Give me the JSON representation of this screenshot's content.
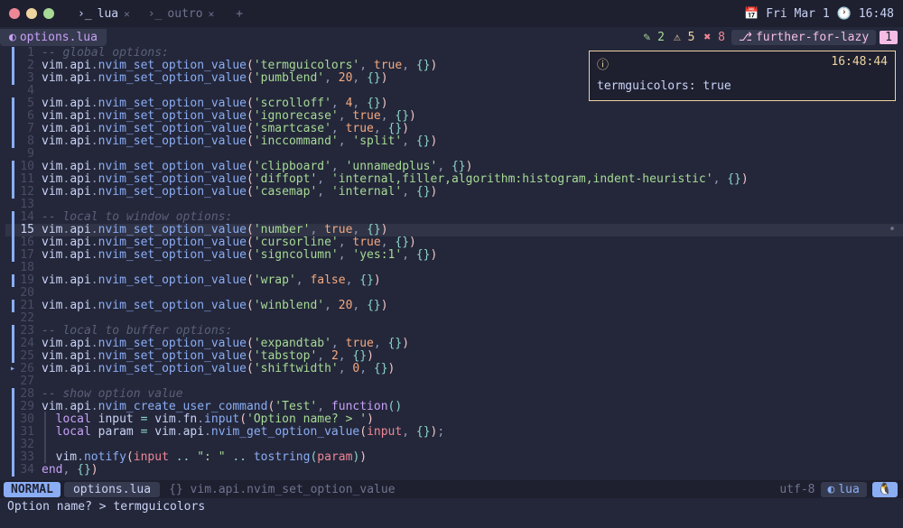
{
  "titlebar": {
    "tabs": [
      {
        "icon": "›_",
        "label": "lua",
        "active": true
      },
      {
        "icon": "›_",
        "label": "outro",
        "active": false
      }
    ],
    "date": "Fri Mar 1",
    "time": "16:48"
  },
  "bufferline": {
    "file": "options.lua",
    "diagnostics": {
      "edits": "2",
      "warnings": "5",
      "errors": "8"
    },
    "branch": "further-for-lazy",
    "branch_count": "1"
  },
  "notification": {
    "time": "16:48:44",
    "message": "termguicolors: true"
  },
  "code_lines": [
    {
      "n": 1,
      "git": "bar",
      "tokens": [
        [
          "comment",
          "-- global options:"
        ]
      ]
    },
    {
      "n": 2,
      "git": "bar",
      "tokens": [
        [
          "id",
          "vim"
        ],
        [
          "punc",
          "."
        ],
        [
          "id",
          "api"
        ],
        [
          "punc",
          "."
        ],
        [
          "fn",
          "nvim_set_option_value"
        ],
        [
          "brc",
          "("
        ],
        [
          "str",
          "'termguicolors'"
        ],
        [
          "punc",
          ", "
        ],
        [
          "bool",
          "true"
        ],
        [
          "punc",
          ", "
        ],
        [
          "brc2",
          "{}"
        ],
        [
          "brc",
          ")"
        ]
      ]
    },
    {
      "n": 3,
      "git": "bar",
      "tokens": [
        [
          "id",
          "vim"
        ],
        [
          "punc",
          "."
        ],
        [
          "id",
          "api"
        ],
        [
          "punc",
          "."
        ],
        [
          "fn",
          "nvim_set_option_value"
        ],
        [
          "brc",
          "("
        ],
        [
          "str",
          "'pumblend'"
        ],
        [
          "punc",
          ", "
        ],
        [
          "num",
          "20"
        ],
        [
          "punc",
          ", "
        ],
        [
          "brc2",
          "{}"
        ],
        [
          "brc",
          ")"
        ]
      ]
    },
    {
      "n": 4,
      "git": "",
      "tokens": []
    },
    {
      "n": 5,
      "git": "bar",
      "tokens": [
        [
          "id",
          "vim"
        ],
        [
          "punc",
          "."
        ],
        [
          "id",
          "api"
        ],
        [
          "punc",
          "."
        ],
        [
          "fn",
          "nvim_set_option_value"
        ],
        [
          "brc",
          "("
        ],
        [
          "str",
          "'scrolloff'"
        ],
        [
          "punc",
          ", "
        ],
        [
          "num",
          "4"
        ],
        [
          "punc",
          ", "
        ],
        [
          "brc2",
          "{}"
        ],
        [
          "brc",
          ")"
        ]
      ]
    },
    {
      "n": 6,
      "git": "bar",
      "tokens": [
        [
          "id",
          "vim"
        ],
        [
          "punc",
          "."
        ],
        [
          "id",
          "api"
        ],
        [
          "punc",
          "."
        ],
        [
          "fn",
          "nvim_set_option_value"
        ],
        [
          "brc",
          "("
        ],
        [
          "str",
          "'ignorecase'"
        ],
        [
          "punc",
          ", "
        ],
        [
          "bool",
          "true"
        ],
        [
          "punc",
          ", "
        ],
        [
          "brc2",
          "{}"
        ],
        [
          "brc",
          ")"
        ]
      ]
    },
    {
      "n": 7,
      "git": "bar",
      "tokens": [
        [
          "id",
          "vim"
        ],
        [
          "punc",
          "."
        ],
        [
          "id",
          "api"
        ],
        [
          "punc",
          "."
        ],
        [
          "fn",
          "nvim_set_option_value"
        ],
        [
          "brc",
          "("
        ],
        [
          "str",
          "'smartcase'"
        ],
        [
          "punc",
          ", "
        ],
        [
          "bool",
          "true"
        ],
        [
          "punc",
          ", "
        ],
        [
          "brc2",
          "{}"
        ],
        [
          "brc",
          ")"
        ]
      ]
    },
    {
      "n": 8,
      "git": "bar",
      "tokens": [
        [
          "id",
          "vim"
        ],
        [
          "punc",
          "."
        ],
        [
          "id",
          "api"
        ],
        [
          "punc",
          "."
        ],
        [
          "fn",
          "nvim_set_option_value"
        ],
        [
          "brc",
          "("
        ],
        [
          "str",
          "'inccommand'"
        ],
        [
          "punc",
          ", "
        ],
        [
          "str",
          "'split'"
        ],
        [
          "punc",
          ", "
        ],
        [
          "brc2",
          "{}"
        ],
        [
          "brc",
          ")"
        ]
      ]
    },
    {
      "n": 9,
      "git": "",
      "tokens": []
    },
    {
      "n": 10,
      "git": "bar",
      "tokens": [
        [
          "id",
          "vim"
        ],
        [
          "punc",
          "."
        ],
        [
          "id",
          "api"
        ],
        [
          "punc",
          "."
        ],
        [
          "fn",
          "nvim_set_option_value"
        ],
        [
          "brc",
          "("
        ],
        [
          "str",
          "'clipboard'"
        ],
        [
          "punc",
          ", "
        ],
        [
          "str",
          "'unnamedplus'"
        ],
        [
          "punc",
          ", "
        ],
        [
          "brc2",
          "{}"
        ],
        [
          "brc",
          ")"
        ]
      ]
    },
    {
      "n": 11,
      "git": "bar",
      "tokens": [
        [
          "id",
          "vim"
        ],
        [
          "punc",
          "."
        ],
        [
          "id",
          "api"
        ],
        [
          "punc",
          "."
        ],
        [
          "fn",
          "nvim_set_option_value"
        ],
        [
          "brc",
          "("
        ],
        [
          "str",
          "'diffopt'"
        ],
        [
          "punc",
          ", "
        ],
        [
          "str",
          "'internal,filler,algorithm:histogram,indent-heuristic'"
        ],
        [
          "punc",
          ", "
        ],
        [
          "brc2",
          "{}"
        ],
        [
          "brc",
          ")"
        ]
      ]
    },
    {
      "n": 12,
      "git": "bar",
      "tokens": [
        [
          "id",
          "vim"
        ],
        [
          "punc",
          "."
        ],
        [
          "id",
          "api"
        ],
        [
          "punc",
          "."
        ],
        [
          "fn",
          "nvim_set_option_value"
        ],
        [
          "brc",
          "("
        ],
        [
          "str",
          "'casemap'"
        ],
        [
          "punc",
          ", "
        ],
        [
          "str",
          "'internal'"
        ],
        [
          "punc",
          ", "
        ],
        [
          "brc2",
          "{}"
        ],
        [
          "brc",
          ")"
        ]
      ]
    },
    {
      "n": 13,
      "git": "",
      "tokens": []
    },
    {
      "n": 14,
      "git": "bar",
      "tokens": [
        [
          "comment",
          "-- local to window options:"
        ]
      ]
    },
    {
      "n": 15,
      "git": "bar",
      "active": true,
      "tokens": [
        [
          "id",
          "vim"
        ],
        [
          "punc",
          "."
        ],
        [
          "id",
          "api"
        ],
        [
          "punc",
          "."
        ],
        [
          "fn",
          "nvim_set_option_value"
        ],
        [
          "brc",
          "("
        ],
        [
          "str",
          "'number'"
        ],
        [
          "punc",
          ", "
        ],
        [
          "bool",
          "true"
        ],
        [
          "punc",
          ", "
        ],
        [
          "brc2",
          "{}"
        ],
        [
          "brc",
          ")"
        ]
      ]
    },
    {
      "n": 16,
      "git": "bar",
      "tokens": [
        [
          "id",
          "vim"
        ],
        [
          "punc",
          "."
        ],
        [
          "id",
          "api"
        ],
        [
          "punc",
          "."
        ],
        [
          "fn",
          "nvim_set_option_value"
        ],
        [
          "brc",
          "("
        ],
        [
          "str",
          "'cursorline'"
        ],
        [
          "punc",
          ", "
        ],
        [
          "bool",
          "true"
        ],
        [
          "punc",
          ", "
        ],
        [
          "brc2",
          "{}"
        ],
        [
          "brc",
          ")"
        ]
      ]
    },
    {
      "n": 17,
      "git": "bar",
      "tokens": [
        [
          "id",
          "vim"
        ],
        [
          "punc",
          "."
        ],
        [
          "id",
          "api"
        ],
        [
          "punc",
          "."
        ],
        [
          "fn",
          "nvim_set_option_value"
        ],
        [
          "brc",
          "("
        ],
        [
          "str",
          "'signcolumn'"
        ],
        [
          "punc",
          ", "
        ],
        [
          "str",
          "'yes:1'"
        ],
        [
          "punc",
          ", "
        ],
        [
          "brc2",
          "{}"
        ],
        [
          "brc",
          ")"
        ]
      ]
    },
    {
      "n": 18,
      "git": "",
      "tokens": []
    },
    {
      "n": 19,
      "git": "bar",
      "tokens": [
        [
          "id",
          "vim"
        ],
        [
          "punc",
          "."
        ],
        [
          "id",
          "api"
        ],
        [
          "punc",
          "."
        ],
        [
          "fn",
          "nvim_set_option_value"
        ],
        [
          "brc",
          "("
        ],
        [
          "str",
          "'wrap'"
        ],
        [
          "punc",
          ", "
        ],
        [
          "bool",
          "false"
        ],
        [
          "punc",
          ", "
        ],
        [
          "brc2",
          "{}"
        ],
        [
          "brc",
          ")"
        ]
      ]
    },
    {
      "n": 20,
      "git": "",
      "tokens": []
    },
    {
      "n": 21,
      "git": "bar",
      "tokens": [
        [
          "id",
          "vim"
        ],
        [
          "punc",
          "."
        ],
        [
          "id",
          "api"
        ],
        [
          "punc",
          "."
        ],
        [
          "fn",
          "nvim_set_option_value"
        ],
        [
          "brc",
          "("
        ],
        [
          "str",
          "'winblend'"
        ],
        [
          "punc",
          ", "
        ],
        [
          "num",
          "20"
        ],
        [
          "punc",
          ", "
        ],
        [
          "brc2",
          "{}"
        ],
        [
          "brc",
          ")"
        ]
      ]
    },
    {
      "n": 22,
      "git": "",
      "tokens": []
    },
    {
      "n": 23,
      "git": "bar",
      "tokens": [
        [
          "comment",
          "-- local to buffer options:"
        ]
      ]
    },
    {
      "n": 24,
      "git": "bar",
      "tokens": [
        [
          "id",
          "vim"
        ],
        [
          "punc",
          "."
        ],
        [
          "id",
          "api"
        ],
        [
          "punc",
          "."
        ],
        [
          "fn",
          "nvim_set_option_value"
        ],
        [
          "brc",
          "("
        ],
        [
          "str",
          "'expandtab'"
        ],
        [
          "punc",
          ", "
        ],
        [
          "bool",
          "true"
        ],
        [
          "punc",
          ", "
        ],
        [
          "brc2",
          "{}"
        ],
        [
          "brc",
          ")"
        ]
      ]
    },
    {
      "n": 25,
      "git": "bar",
      "tokens": [
        [
          "id",
          "vim"
        ],
        [
          "punc",
          "."
        ],
        [
          "id",
          "api"
        ],
        [
          "punc",
          "."
        ],
        [
          "fn",
          "nvim_set_option_value"
        ],
        [
          "brc",
          "("
        ],
        [
          "str",
          "'tabstop'"
        ],
        [
          "punc",
          ", "
        ],
        [
          "num",
          "2"
        ],
        [
          "punc",
          ", "
        ],
        [
          "brc2",
          "{}"
        ],
        [
          "brc",
          ")"
        ]
      ]
    },
    {
      "n": 26,
      "git": "tri",
      "tokens": [
        [
          "id",
          "vim"
        ],
        [
          "punc",
          "."
        ],
        [
          "id",
          "api"
        ],
        [
          "punc",
          "."
        ],
        [
          "fn",
          "nvim_set_option_value"
        ],
        [
          "brc",
          "("
        ],
        [
          "str",
          "'shiftwidth'"
        ],
        [
          "punc",
          ", "
        ],
        [
          "num",
          "0"
        ],
        [
          "punc",
          ", "
        ],
        [
          "brc2",
          "{}"
        ],
        [
          "brc",
          ")"
        ]
      ]
    },
    {
      "n": 27,
      "git": "",
      "tokens": []
    },
    {
      "n": 28,
      "git": "bar",
      "tokens": [
        [
          "comment",
          "-- show option value"
        ]
      ]
    },
    {
      "n": 29,
      "git": "bar",
      "tokens": [
        [
          "id",
          "vim"
        ],
        [
          "punc",
          "."
        ],
        [
          "id",
          "api"
        ],
        [
          "punc",
          "."
        ],
        [
          "fn",
          "nvim_create_user_command"
        ],
        [
          "brc",
          "("
        ],
        [
          "str",
          "'Test'"
        ],
        [
          "punc",
          ", "
        ],
        [
          "kw",
          "function"
        ],
        [
          "brc2",
          "()"
        ]
      ]
    },
    {
      "n": 30,
      "git": "bar",
      "indent": 1,
      "tokens": [
        [
          "kw",
          "local"
        ],
        [
          "id",
          " input "
        ],
        [
          "op",
          "="
        ],
        [
          "id",
          " vim"
        ],
        [
          "punc",
          "."
        ],
        [
          "id",
          "fn"
        ],
        [
          "punc",
          "."
        ],
        [
          "fn",
          "input"
        ],
        [
          "brc",
          "("
        ],
        [
          "str",
          "'Option name? > '"
        ],
        [
          "brc",
          ")"
        ]
      ]
    },
    {
      "n": 31,
      "git": "bar",
      "indent": 1,
      "tokens": [
        [
          "kw",
          "local"
        ],
        [
          "id",
          " param "
        ],
        [
          "op",
          "="
        ],
        [
          "id",
          " vim"
        ],
        [
          "punc",
          "."
        ],
        [
          "id",
          "api"
        ],
        [
          "punc",
          "."
        ],
        [
          "fn",
          "nvim_get_option_value"
        ],
        [
          "brc",
          "("
        ],
        [
          "param",
          "input"
        ],
        [
          "punc",
          ", "
        ],
        [
          "brc2",
          "{}"
        ],
        [
          "brc",
          ")"
        ],
        [
          "punc",
          ";"
        ]
      ]
    },
    {
      "n": 32,
      "git": "bar",
      "indent": 1,
      "tokens": []
    },
    {
      "n": 33,
      "git": "bar",
      "indent": 1,
      "tokens": [
        [
          "id",
          "vim"
        ],
        [
          "punc",
          "."
        ],
        [
          "fn",
          "notify"
        ],
        [
          "brc",
          "("
        ],
        [
          "param",
          "input"
        ],
        [
          "id",
          " "
        ],
        [
          "op",
          ".."
        ],
        [
          "id",
          " "
        ],
        [
          "str",
          "\": \""
        ],
        [
          "id",
          " "
        ],
        [
          "op",
          ".."
        ],
        [
          "id",
          " "
        ],
        [
          "fn",
          "tostring"
        ],
        [
          "brc2",
          "("
        ],
        [
          "param",
          "param"
        ],
        [
          "brc2",
          ")"
        ],
        [
          "brc",
          ")"
        ]
      ]
    },
    {
      "n": 34,
      "git": "bar",
      "tokens": [
        [
          "kw",
          "end"
        ],
        [
          "punc",
          ", "
        ],
        [
          "brc2",
          "{}"
        ],
        [
          "brc",
          ")"
        ]
      ]
    }
  ],
  "statusline": {
    "mode": "NORMAL",
    "file": "options.lua",
    "context_icon": "{}",
    "context": "vim.api.nvim_set_option_value",
    "encoding": "utf-8",
    "language": "lua"
  },
  "cmdline": {
    "prompt": "Option name? > ",
    "input": "termguicolors"
  }
}
